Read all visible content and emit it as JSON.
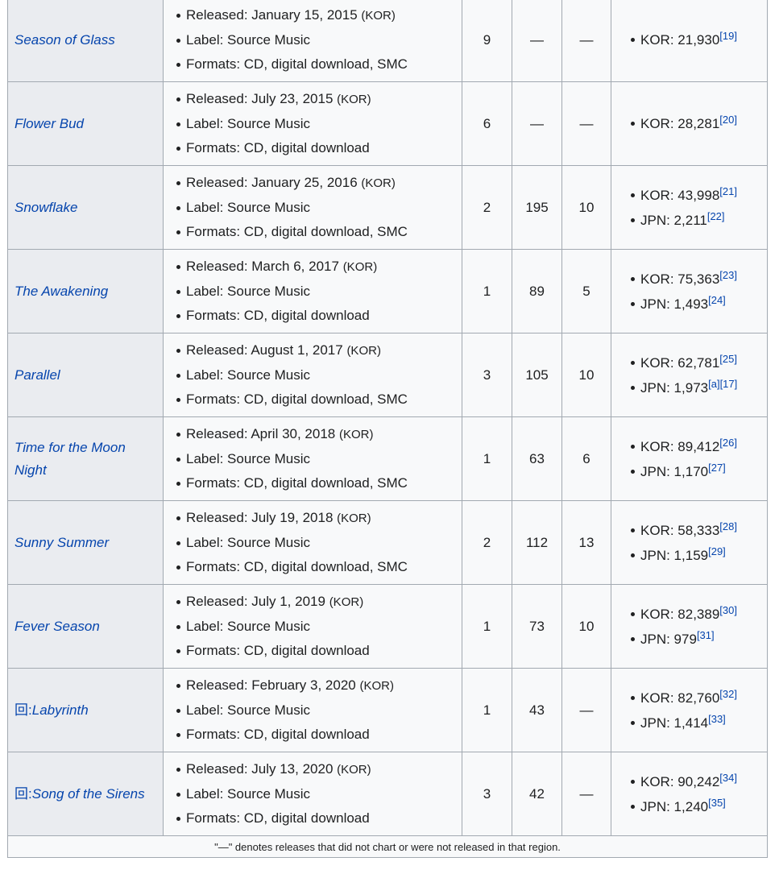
{
  "rows": [
    {
      "title_prefix": "",
      "title": "Season of Glass",
      "released": "Released: January 15, 2015",
      "region": "(KOR)",
      "label": "Label: Source Music",
      "formats": "Formats: CD, digital download, SMC",
      "kor_peak": "9",
      "jpn_peak": "—",
      "jpn_hot_peak": "—",
      "sales": [
        {
          "text": "KOR: 21,930",
          "ref": "[19]"
        }
      ]
    },
    {
      "title_prefix": "",
      "title": "Flower Bud",
      "released": "Released: July 23, 2015",
      "region": "(KOR)",
      "label": "Label: Source Music",
      "formats": "Formats: CD, digital download",
      "kor_peak": "6",
      "jpn_peak": "—",
      "jpn_hot_peak": "—",
      "sales": [
        {
          "text": "KOR: 28,281",
          "ref": "[20]"
        }
      ]
    },
    {
      "title_prefix": "",
      "title": "Snowflake",
      "released": "Released: January 25, 2016",
      "region": "(KOR)",
      "label": "Label: Source Music",
      "formats": "Formats: CD, digital download, SMC",
      "kor_peak": "2",
      "jpn_peak": "195",
      "jpn_hot_peak": "10",
      "sales": [
        {
          "text": "KOR: 43,998",
          "ref": "[21]"
        },
        {
          "text": "JPN: 2,211",
          "ref": "[22]"
        }
      ]
    },
    {
      "title_prefix": "",
      "title": "The Awakening",
      "released": "Released: March 6, 2017",
      "region": "(KOR)",
      "label": "Label: Source Music",
      "formats": "Formats: CD, digital download",
      "kor_peak": "1",
      "jpn_peak": "89",
      "jpn_hot_peak": "5",
      "sales": [
        {
          "text": "KOR: 75,363",
          "ref": "[23]"
        },
        {
          "text": "JPN: 1,493",
          "ref": "[24]"
        }
      ]
    },
    {
      "title_prefix": "",
      "title": "Parallel",
      "released": "Released: August 1, 2017",
      "region": "(KOR)",
      "label": "Label: Source Music",
      "formats": "Formats: CD, digital download, SMC",
      "kor_peak": "3",
      "jpn_peak": "105",
      "jpn_hot_peak": "10",
      "sales": [
        {
          "text": "KOR: 62,781",
          "ref": "[25]"
        },
        {
          "text": "JPN: 1,973",
          "ref": "[a][17]"
        }
      ]
    },
    {
      "title_prefix": "",
      "title": "Time for the Moon Night",
      "released": "Released: April 30, 2018",
      "region": "(KOR)",
      "label": "Label: Source Music",
      "formats": "Formats: CD, digital download, SMC",
      "kor_peak": "1",
      "jpn_peak": "63",
      "jpn_hot_peak": "6",
      "sales": [
        {
          "text": "KOR: 89,412",
          "ref": "[26]"
        },
        {
          "text": "JPN: 1,170",
          "ref": "[27]"
        }
      ]
    },
    {
      "title_prefix": "",
      "title": "Sunny Summer",
      "released": "Released: July 19, 2018",
      "region": "(KOR)",
      "label": "Label: Source Music",
      "formats": "Formats: CD, digital download, SMC",
      "kor_peak": "2",
      "jpn_peak": "112",
      "jpn_hot_peak": "13",
      "sales": [
        {
          "text": "KOR: 58,333",
          "ref": "[28]"
        },
        {
          "text": "JPN: 1,159",
          "ref": "[29]"
        }
      ]
    },
    {
      "title_prefix": "",
      "title": "Fever Season",
      "released": "Released: July 1, 2019",
      "region": "(KOR)",
      "label": "Label: Source Music",
      "formats": "Formats: CD, digital download",
      "kor_peak": "1",
      "jpn_peak": "73",
      "jpn_hot_peak": "10",
      "sales": [
        {
          "text": "KOR: 82,389",
          "ref": "[30]"
        },
        {
          "text": "JPN: 979",
          "ref": "[31]"
        }
      ]
    },
    {
      "title_prefix": "回:",
      "title": "Labyrinth",
      "released": "Released: February 3, 2020",
      "region": "(KOR)",
      "label": "Label: Source Music",
      "formats": "Formats: CD, digital download",
      "kor_peak": "1",
      "jpn_peak": "43",
      "jpn_hot_peak": "—",
      "sales": [
        {
          "text": "KOR: 82,760",
          "ref": "[32]"
        },
        {
          "text": "JPN: 1,414",
          "ref": "[33]"
        }
      ]
    },
    {
      "title_prefix": "回:",
      "title": "Song of the Sirens",
      "released": "Released: July 13, 2020",
      "region": "(KOR)",
      "label": "Label: Source Music",
      "formats": "Formats: CD, digital download",
      "kor_peak": "3",
      "jpn_peak": "42",
      "jpn_hot_peak": "—",
      "sales": [
        {
          "text": "KOR: 90,242",
          "ref": "[34]"
        },
        {
          "text": "JPN: 1,240",
          "ref": "[35]"
        }
      ]
    }
  ],
  "footnote": "\"—\" denotes releases that did not chart or were not released in that region."
}
